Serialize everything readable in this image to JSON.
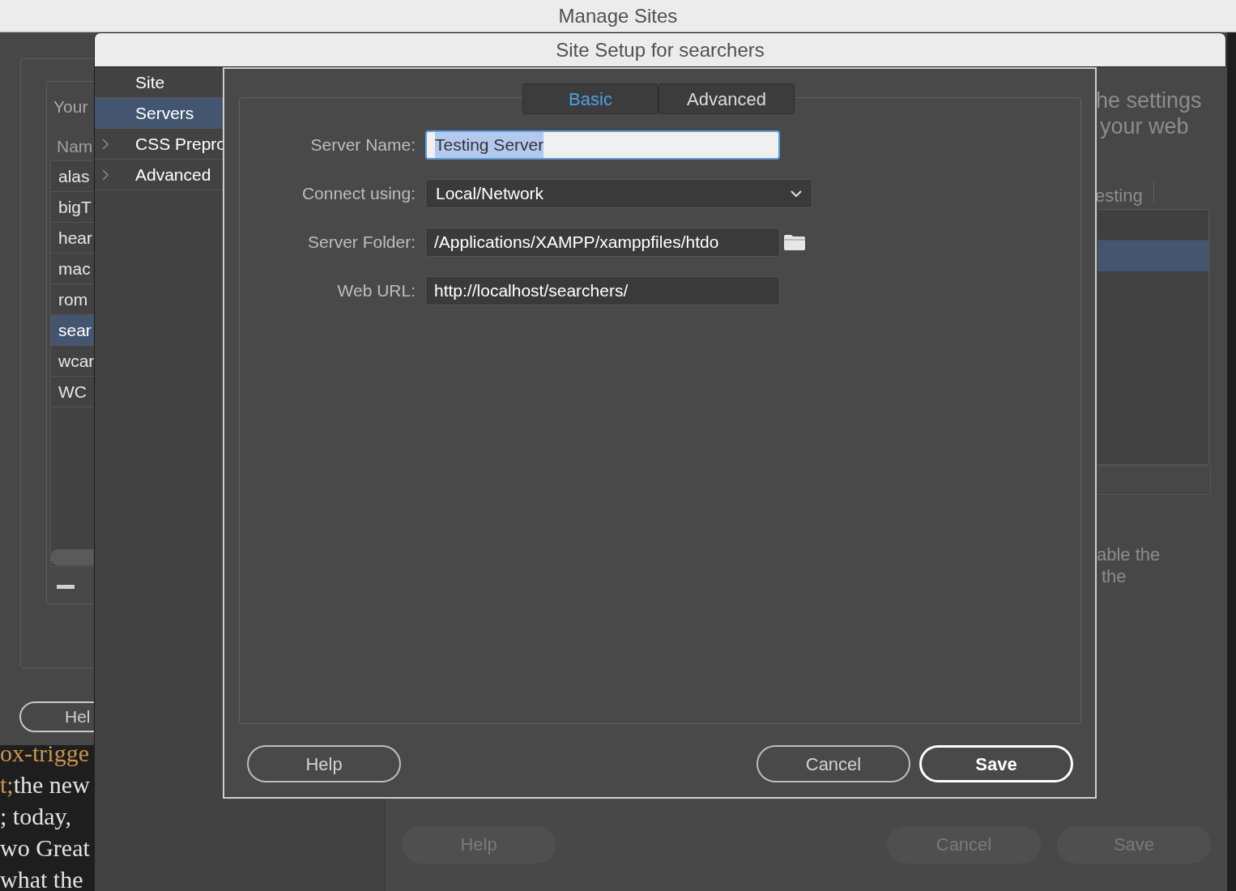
{
  "back_window": {
    "title": "Manage Sites",
    "intro_fragment": "Your",
    "column_header": "Nam",
    "sites": [
      {
        "label": "alas",
        "selected": false
      },
      {
        "label": "bigT",
        "selected": false
      },
      {
        "label": "hear",
        "selected": false
      },
      {
        "label": "mac",
        "selected": false
      },
      {
        "label": "rom",
        "selected": false
      },
      {
        "label": "sear",
        "selected": true
      },
      {
        "label": "wcar",
        "selected": false
      },
      {
        "label": "WC",
        "selected": false
      }
    ],
    "help_button": "Hel",
    "right_text": [
      "he settings",
      "your web"
    ],
    "tab_fragment": "esting",
    "server_rows": [
      {
        "selected": false
      },
      {
        "selected": true
      }
    ],
    "note_text": [
      "able the",
      "the"
    ],
    "buttons": [
      {
        "label": "Help",
        "disabled": true
      },
      {
        "label": "Cancel",
        "disabled": true
      },
      {
        "label": "Save",
        "disabled": true
      }
    ]
  },
  "editor_lines": [
    [
      {
        "text": "ox-trigge",
        "kind": "markup"
      }
    ],
    [
      {
        "text": "t;",
        "kind": "markup"
      },
      {
        "text": "the new",
        "kind": "plain"
      }
    ],
    [
      {
        "text": "; today,",
        "kind": "plain"
      }
    ],
    [
      {
        "text": "wo Great",
        "kind": "plain"
      }
    ],
    [
      {
        "text": "what the",
        "kind": "plain"
      }
    ]
  ],
  "dialog": {
    "title": "Site Setup for searchers",
    "sidebar": [
      {
        "label": "Site",
        "selected": false,
        "expandable": false
      },
      {
        "label": "Servers",
        "selected": true,
        "expandable": false
      },
      {
        "label": "CSS Prepro",
        "selected": false,
        "expandable": true
      },
      {
        "label": "Advanced",
        "selected": false,
        "expandable": true
      }
    ],
    "tabs": [
      {
        "label": "Basic",
        "selected": true
      },
      {
        "label": "Advanced",
        "selected": false
      }
    ],
    "fields": [
      {
        "label": "Server Name:",
        "kind": "text",
        "value": "Testing Server",
        "focused": true
      },
      {
        "label": "Connect using:",
        "kind": "select",
        "value": "Local/Network",
        "focused": false
      },
      {
        "label": "Server Folder:",
        "kind": "folder",
        "value": "/Applications/XAMPP/xamppfiles/htdo",
        "focused": false
      },
      {
        "label": "Web URL:",
        "kind": "text",
        "value": "http://localhost/searchers/",
        "focused": false
      }
    ],
    "buttons": [
      {
        "label": "Help",
        "default": false
      },
      {
        "label": "Cancel",
        "default": false
      },
      {
        "label": "Save",
        "default": true
      }
    ]
  }
}
